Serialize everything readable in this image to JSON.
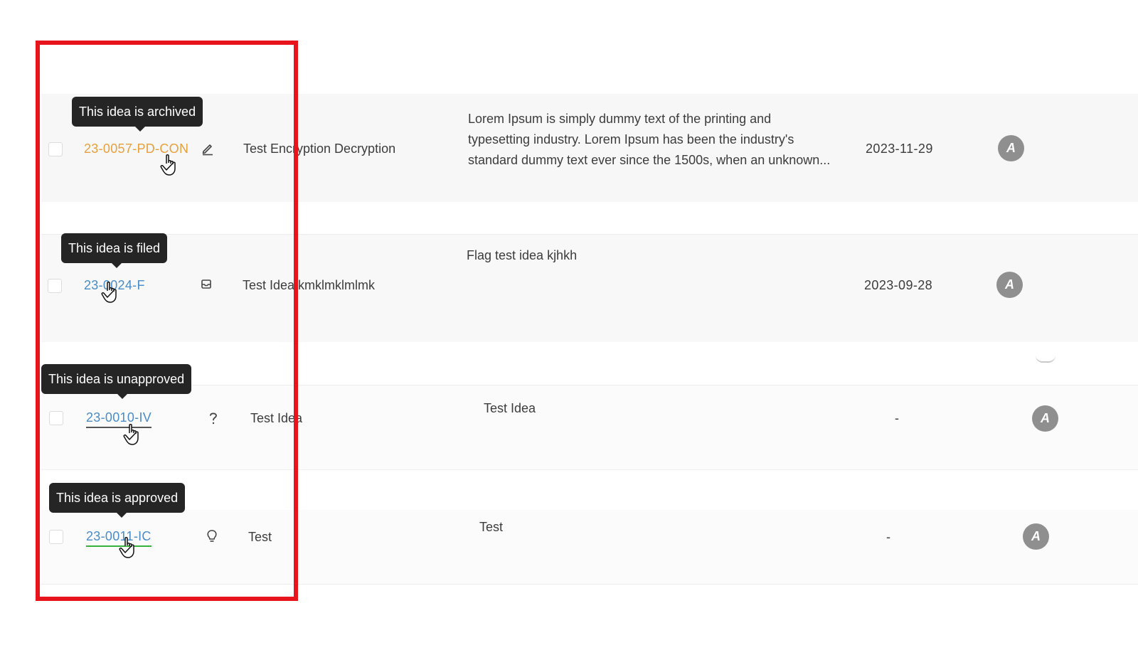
{
  "rows": [
    {
      "id": "23-0057-PD-CON",
      "status_icon": "pencil-icon",
      "title": "Test Encryption Decryption",
      "description": "Lorem Ipsum is simply dummy text of the printing and typesetting industry. Lorem Ipsum has been the industry's standard dummy text ever since the 1500s, when an unknown...",
      "date": "2023-11-29",
      "avatar": "A",
      "tooltip": "This idea is archived"
    },
    {
      "id": "23-0024-F",
      "status_icon": "inbox-icon",
      "title": "Test Idea kmklmklmlmk",
      "description": "Flag test idea kjhkh",
      "date": "2023-09-28",
      "avatar": "A",
      "tooltip": "This idea is filed"
    },
    {
      "id": "23-0010-IV",
      "status_icon": "question-icon",
      "title": "Test Idea",
      "description": "Test Idea",
      "date": "-",
      "avatar": "A",
      "tooltip": "This idea is unapproved"
    },
    {
      "id": "23-0011-IC",
      "status_icon": "lightbulb-icon",
      "title": "Test",
      "description": "Test",
      "date": "-",
      "avatar": "A",
      "tooltip": "This idea is approved"
    }
  ],
  "colors": {
    "archived_id": "#e8a03c",
    "link_id": "#4a8cc9",
    "approved_underline": "#38b33a",
    "highlight_border": "#e8141b",
    "tooltip_bg": "#252525",
    "avatar_bg": "#8f8f8f"
  }
}
